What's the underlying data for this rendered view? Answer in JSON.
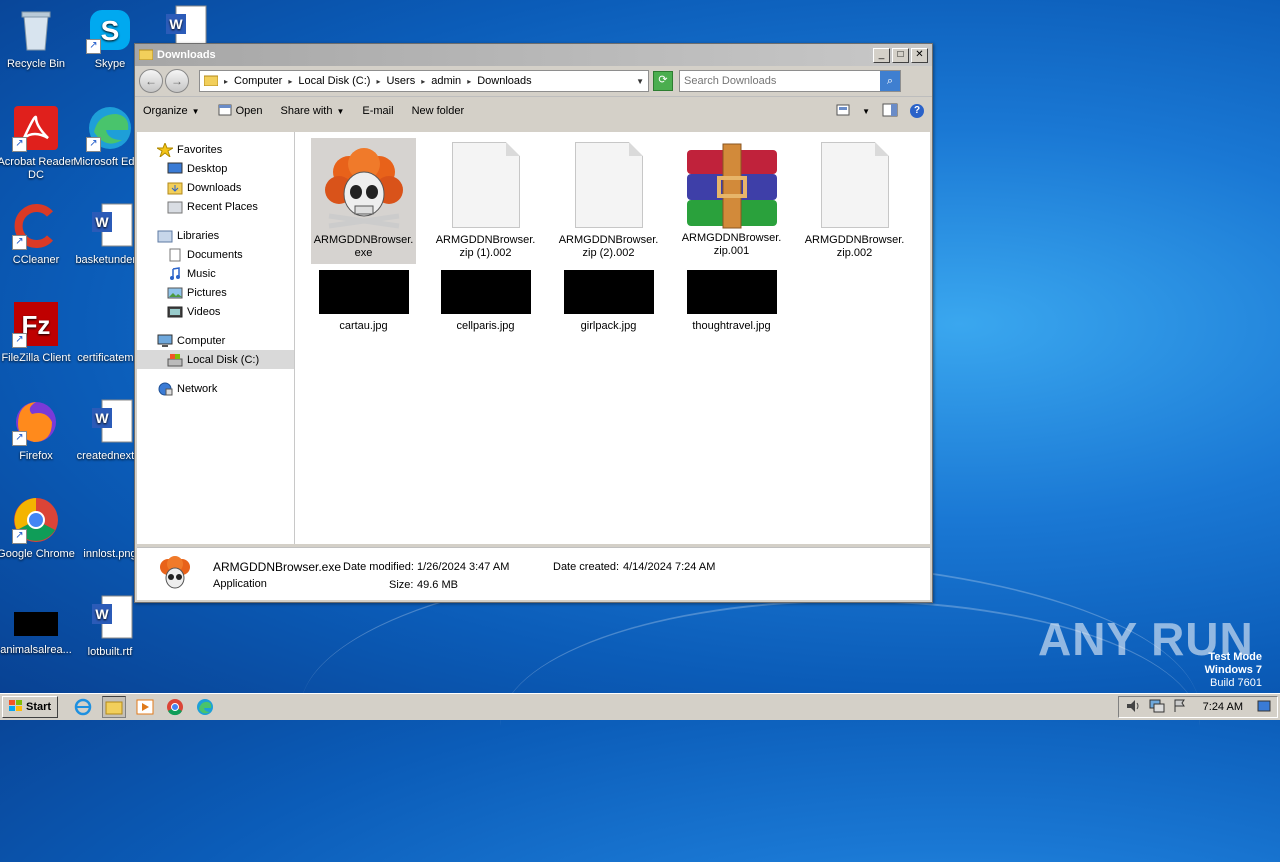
{
  "desktop": {
    "icons": [
      {
        "label": "Recycle Bin"
      },
      {
        "label": "Skype"
      },
      {
        "label": "Acrobat Reader DC"
      },
      {
        "label": "Microsoft Edge"
      },
      {
        "label": "CCleaner"
      },
      {
        "label": "basketunder..."
      },
      {
        "label": "FileZilla Client"
      },
      {
        "label": "certificatem..."
      },
      {
        "label": "Firefox"
      },
      {
        "label": "creatednext..."
      },
      {
        "label": "Google Chrome"
      },
      {
        "label": "innlost.png"
      },
      {
        "label": "animalsalrea..."
      },
      {
        "label": "lotbuilt.rtf"
      }
    ]
  },
  "window": {
    "title": "Downloads",
    "breadcrumb": [
      "Computer",
      "Local Disk (C:)",
      "Users",
      "admin",
      "Downloads"
    ],
    "search_placeholder": "Search Downloads",
    "toolbar": {
      "organize": "Organize",
      "open": "Open",
      "share_with": "Share with",
      "email": "E-mail",
      "new_folder": "New folder"
    },
    "nav": {
      "favorites": "Favorites",
      "desktop": "Desktop",
      "downloads": "Downloads",
      "recent_places": "Recent Places",
      "libraries": "Libraries",
      "documents": "Documents",
      "music": "Music",
      "pictures": "Pictures",
      "videos": "Videos",
      "computer": "Computer",
      "local_disk": "Local Disk (C:)",
      "network": "Network"
    },
    "files": [
      {
        "name_l1": "ARMGDDNBrowser.",
        "name_l2": "exe",
        "kind": "exe"
      },
      {
        "name_l1": "ARMGDDNBrowser.",
        "name_l2": "zip (1).002",
        "kind": "doc"
      },
      {
        "name_l1": "ARMGDDNBrowser.",
        "name_l2": "zip (2).002",
        "kind": "doc"
      },
      {
        "name_l1": "ARMGDDNBrowser.",
        "name_l2": "zip.001",
        "kind": "rar"
      },
      {
        "name_l1": "ARMGDDNBrowser.",
        "name_l2": "zip.002",
        "kind": "doc"
      },
      {
        "name_l1": "cartau.jpg",
        "kind": "jpg"
      },
      {
        "name_l1": "cellparis.jpg",
        "kind": "jpg"
      },
      {
        "name_l1": "girlpack.jpg",
        "kind": "jpg"
      },
      {
        "name_l1": "thoughtravel.jpg",
        "kind": "jpg"
      }
    ],
    "details": {
      "filename": "ARMGDDNBrowser.exe",
      "type": "Application",
      "date_modified_label": "Date modified:",
      "date_modified": "1/26/2024 3:47 AM",
      "size_label": "Size:",
      "size": "49.6 MB",
      "date_created_label": "Date created:",
      "date_created": "4/14/2024 7:24 AM"
    }
  },
  "watermark": {
    "brand": "ANY RUN",
    "line1": "Test Mode",
    "line2": "Windows 7",
    "line3": "Build 7601"
  },
  "taskbar": {
    "start": "Start",
    "clock": "7:24 AM"
  }
}
